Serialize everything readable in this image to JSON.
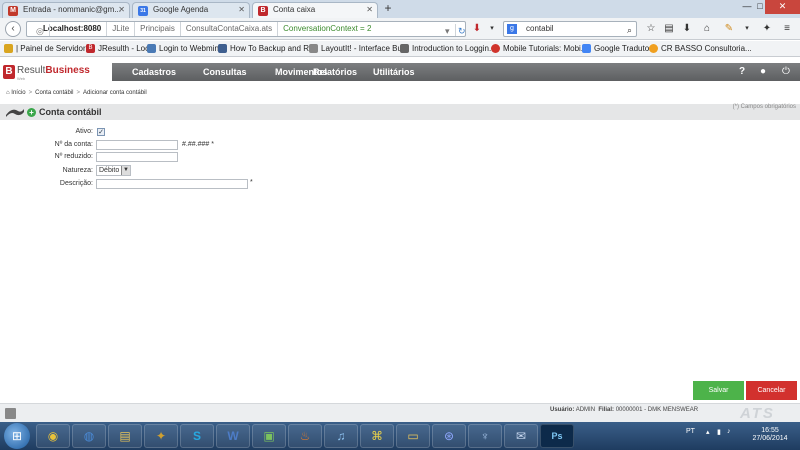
{
  "browser": {
    "tabs": [
      {
        "title": "Entrada - nommanic@gm...",
        "icon": "gmail-icon",
        "color": "#c1392b",
        "glyph": "M"
      },
      {
        "title": "Google Agenda",
        "icon": "google-calendar-icon",
        "color": "#3b78e7",
        "glyph": "31"
      },
      {
        "title": "Conta caixa",
        "icon": "resulth-favicon",
        "color": "#c0282d",
        "glyph": "B"
      }
    ],
    "new_tab": "+",
    "window_controls": {
      "minimize": "—",
      "maximize": "□",
      "close": "✕"
    },
    "url": {
      "host": "Localhost:8080",
      "segments": [
        "JLite",
        "Principais",
        "ConsultaContaCaixa.ats"
      ],
      "context": "ConversationContext = 2"
    },
    "search": {
      "engine_icon": "google-icon",
      "value": "contabil"
    },
    "bookmarks": [
      {
        "label": "| Painel de Servidores",
        "icon": "folder-icon",
        "color": "#d9a520"
      },
      {
        "label": "JResulth - Local",
        "icon": "resulth-favicon",
        "color": "#c0282d"
      },
      {
        "label": "Login to Webmin",
        "icon": "webmin-icon",
        "color": "#4a7ab5"
      },
      {
        "label": "How To Backup and R...",
        "icon": "page-icon",
        "color": "#3f5f8f"
      },
      {
        "label": "LayoutIt! - Interface Bu...",
        "icon": "layoutit-icon",
        "color": "#888888"
      },
      {
        "label": "Introduction to Loggin...",
        "icon": "page-icon",
        "color": "#666666"
      },
      {
        "label": "Mobile Tutorials: Mobi...",
        "icon": "mobile-tutorials-icon",
        "color": "#d0342c"
      },
      {
        "label": "Google Tradutor",
        "icon": "google-translate-icon",
        "color": "#4285f4"
      },
      {
        "label": "CR BASSO Consultoria...",
        "icon": "crbasso-icon",
        "color": "#f0a020"
      }
    ]
  },
  "app": {
    "logo": {
      "brand": "Result",
      "brand_bold": "Business",
      "sub": "Web"
    },
    "menu": [
      "Cadastros",
      "Consultas",
      "Movimentos",
      "Relatórios",
      "Utilitários"
    ],
    "breadcrumb": [
      "Início",
      "Conta contábil",
      "Adicionar conta contábil"
    ],
    "page_title": "Conta contábil",
    "required_note": "(*) Campos obrigatórios",
    "form": {
      "ativo_label": "Ativo:",
      "ativo_checked": "✓",
      "numero_label": "Nº da conta:",
      "numero_value": "",
      "numero_mask": "#.##.### *",
      "reduzido_label": "Nº reduzido:",
      "reduzido_value": "",
      "natureza_label": "Natureza:",
      "natureza_value": "Débito",
      "descricao_label": "Descrição:",
      "descricao_value": "",
      "descricao_required": "*"
    },
    "buttons": {
      "save": "Salvar",
      "cancel": "Cancelar"
    },
    "footer": {
      "user_label": "Usuário:",
      "user": "ADMIN",
      "branch_label": "Filial:",
      "branch": "00000001 - DMK MENSWEAR",
      "brand": "ATS"
    }
  },
  "taskbar": {
    "apps": [
      {
        "name": "chrome",
        "glyph": "◉"
      },
      {
        "name": "firefox",
        "glyph": "◍"
      },
      {
        "name": "explorer",
        "glyph": "▤"
      },
      {
        "name": "game",
        "glyph": "✦"
      },
      {
        "name": "skype",
        "glyph": "S"
      },
      {
        "name": "word",
        "glyph": "W"
      },
      {
        "name": "image-viewer",
        "glyph": "▣"
      },
      {
        "name": "java",
        "glyph": "♨"
      },
      {
        "name": "media",
        "glyph": "♫"
      },
      {
        "name": "python",
        "glyph": "⌘"
      },
      {
        "name": "folder",
        "glyph": "▭"
      },
      {
        "name": "network",
        "glyph": "⊛"
      },
      {
        "name": "postgres",
        "glyph": "♆"
      },
      {
        "name": "thunderbird",
        "glyph": "✉"
      },
      {
        "name": "photoshop",
        "glyph": "Ps"
      }
    ],
    "language": "PT",
    "time": "16:55",
    "date": "27/06/2014"
  }
}
